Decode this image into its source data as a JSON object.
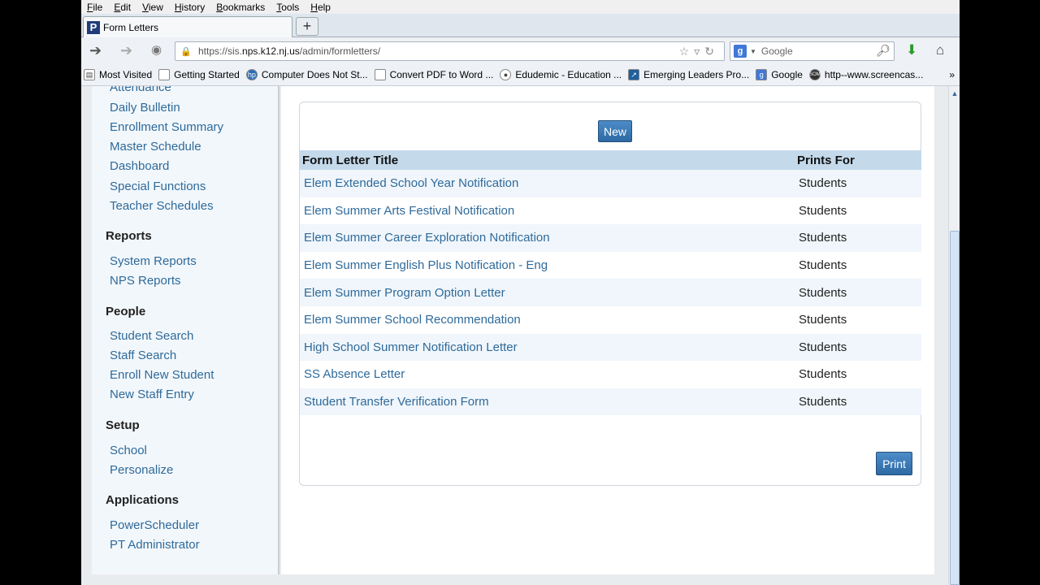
{
  "browser": {
    "menu": [
      "File",
      "Edit",
      "View",
      "History",
      "Bookmarks",
      "Tools",
      "Help"
    ],
    "tab_title": "Form Letters",
    "tab_icon": "powerschool-p-icon",
    "url_prefix": "https://sis.",
    "url_domain": "nps.k12.nj.us",
    "url_path": "/admin/formletters/",
    "search_placeholder": "Google",
    "bookmarks": [
      {
        "label": "Most Visited",
        "icon": "folder-icon"
      },
      {
        "label": "Getting Started",
        "icon": "page-icon"
      },
      {
        "label": "Computer Does Not St...",
        "icon": "hp-icon"
      },
      {
        "label": "Convert PDF to Word ...",
        "icon": "page-icon"
      },
      {
        "label": "Edudemic - Education ...",
        "icon": "apple-icon"
      },
      {
        "label": "Emerging Leaders Pro...",
        "icon": "arrow-icon"
      },
      {
        "label": "Google",
        "icon": "google-icon"
      },
      {
        "label": "http--www.screencas...",
        "icon": "screencast-icon"
      }
    ]
  },
  "sidebar": {
    "partial_top": "Attendance",
    "links1": [
      "Daily Bulletin",
      "Enrollment Summary",
      "Master Schedule",
      "Dashboard",
      "Special Functions",
      "Teacher Schedules"
    ],
    "reports_heading": "Reports",
    "reports": [
      "System Reports",
      "NPS Reports"
    ],
    "people_heading": "People",
    "people": [
      "Student Search",
      "Staff Search",
      "Enroll New Student",
      "New Staff Entry"
    ],
    "setup_heading": "Setup",
    "setup": [
      "School",
      "Personalize"
    ],
    "applications_heading": "Applications",
    "applications": [
      "PowerScheduler",
      "PT Administrator"
    ]
  },
  "main": {
    "new_button": "New",
    "print_button": "Print",
    "columns": [
      "Form Letter Title",
      "Prints For"
    ],
    "rows": [
      [
        "Elem Extended School Year Notification",
        "Students"
      ],
      [
        "Elem Summer Arts Festival Notification",
        "Students"
      ],
      [
        "Elem Summer Career Exploration Notification",
        "Students"
      ],
      [
        "Elem Summer English Plus Notification - Eng",
        "Students"
      ],
      [
        "Elem Summer Program Option Letter",
        "Students"
      ],
      [
        "Elem Summer School Recommendation",
        "Students"
      ],
      [
        "High School Summer Notification Letter",
        "Students"
      ],
      [
        "SS Absence Letter",
        "Students"
      ],
      [
        "Student Transfer Verification Form",
        "Students"
      ]
    ]
  },
  "colors": {
    "link": "#2f6a9a",
    "header_row": "#c4d9ea",
    "button": "#2e6aa4"
  }
}
